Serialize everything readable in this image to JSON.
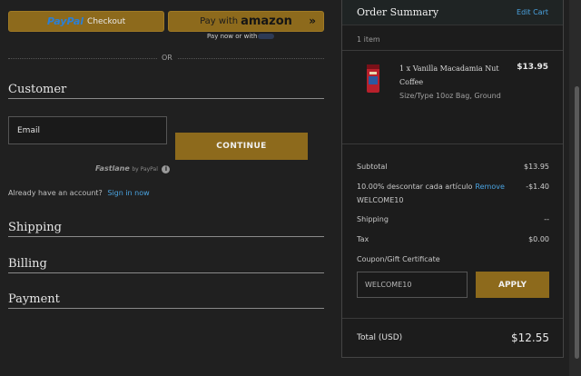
{
  "express": {
    "paypal_logo": "PayPal",
    "paypal_text": "Checkout",
    "amazon_prefix": "Pay with",
    "amazon_word": "amazon",
    "amazon_sub": "Pay now or with",
    "or_text": "OR"
  },
  "customer": {
    "title": "Customer",
    "email_label": "Email",
    "continue_label": "CONTINUE",
    "fastlane": "Fastlane",
    "fastlane_by": "by PayPal",
    "signin_prompt": "Already have an account?",
    "signin_link": "Sign in now"
  },
  "sections": {
    "shipping": "Shipping",
    "billing": "Billing",
    "payment": "Payment"
  },
  "summary": {
    "title": "Order Summary",
    "edit_cart": "Edit Cart",
    "item_count": "1 item",
    "product": {
      "name": "1 x Vanilla Macadamia Nut Coffee",
      "price": "$13.95",
      "size": "Size/Type 10oz Bag, Ground"
    },
    "subtotal_label": "Subtotal",
    "subtotal_value": "$13.95",
    "discount_label": "10.00% descontar cada artículo",
    "discount_remove": "Remove",
    "discount_value": "-$1.40",
    "discount_code": "WELCOME10",
    "shipping_label": "Shipping",
    "shipping_value": "--",
    "tax_label": "Tax",
    "tax_value": "$0.00",
    "coupon_label": "Coupon/Gift Certificate",
    "coupon_value": "WELCOME10",
    "apply_label": "APPLY",
    "total_label": "Total (USD)",
    "total_value": "$12.55"
  },
  "colors": {
    "accent_gold": "#8d6a1c",
    "link_blue": "#4aa3e0",
    "background": "#202020"
  }
}
